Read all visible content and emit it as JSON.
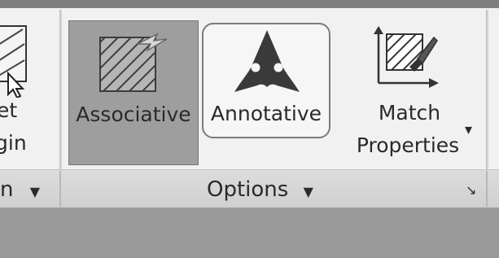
{
  "ribbon": {
    "left_panel": {
      "button_label_line1": "et",
      "button_label_line2": "gin",
      "panel_label": "n",
      "dropdown_glyph": "▼"
    },
    "options_panel": {
      "title": "Options",
      "dropdown_glyph": "▼",
      "launcher_glyph": "↘",
      "buttons": [
        {
          "label": "Associative",
          "icon": "associative-hatch-icon",
          "state": "active"
        },
        {
          "label": "Annotative",
          "icon": "annotative-icon",
          "state": "normal"
        },
        {
          "label_line1": "Match",
          "label_line2": "Properties",
          "icon": "match-properties-icon",
          "dropdown_glyph": "▾"
        }
      ]
    }
  }
}
